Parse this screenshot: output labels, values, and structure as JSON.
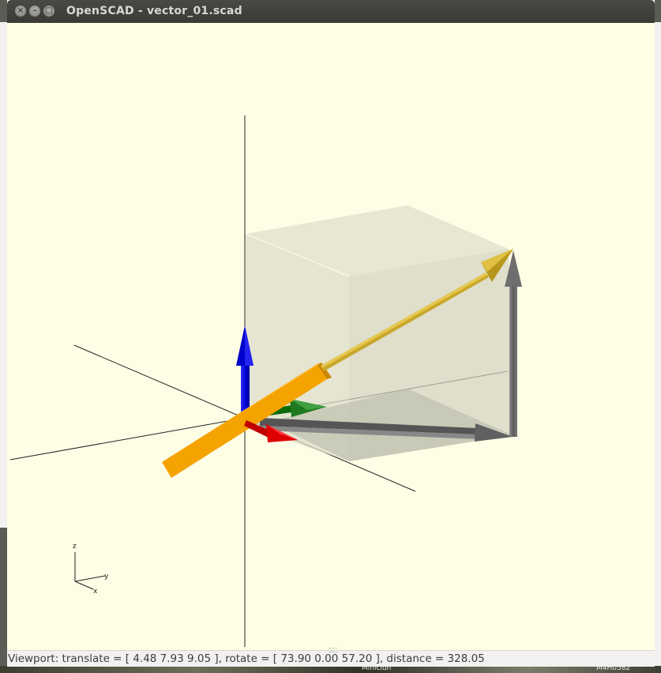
{
  "window": {
    "title": "OpenSCAD - vector_01.scad",
    "close_glyph": "×",
    "minimize_glyph": "–",
    "maximize_glyph": "□"
  },
  "status": {
    "viewport": "Viewport: translate = [ 4.48 7.93 9.05 ], rotate = [ 73.90 0.00 57.20 ], distance = 328.05"
  },
  "axes_indicator": {
    "x": "x",
    "y": "y",
    "z": "z"
  },
  "background": {
    "bottom_text_1": "Minicluh",
    "bottom_text_2": "M4H0582"
  },
  "colors": {
    "viewport_bg": "#fefee6",
    "axis_x": "#cc0000",
    "axis_y": "#0a6a0a",
    "axis_z": "#0000dd",
    "vector": "#f5a300",
    "vector_arrow": "#d8b030",
    "cube": "#dcdccb",
    "component_arrows": "#707070"
  }
}
